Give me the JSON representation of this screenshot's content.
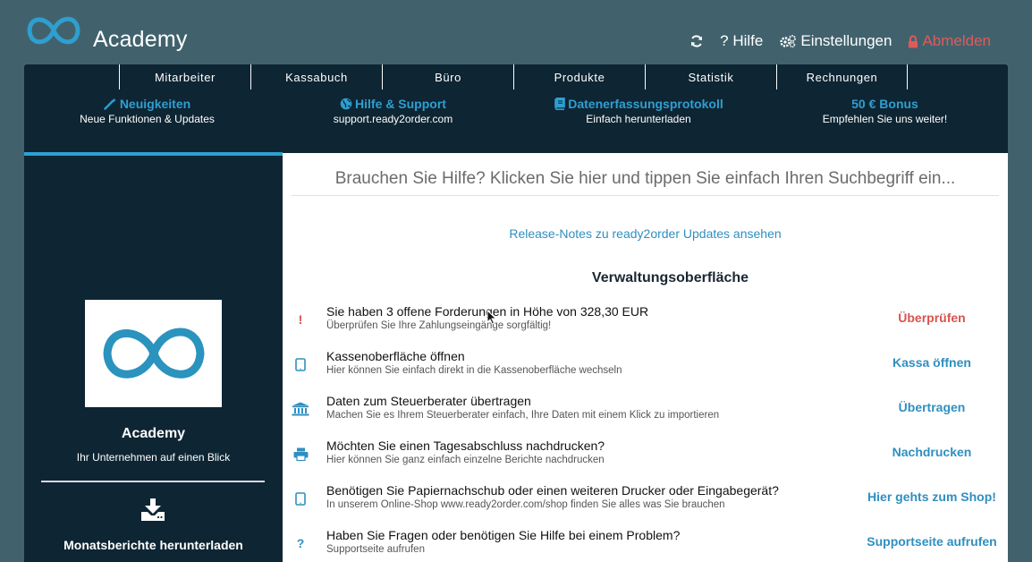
{
  "header": {
    "brand_name": "Academy",
    "actions": {
      "refresh_icon": "refresh-icon",
      "help_label": "? Hilfe",
      "settings_label": "Einstellungen",
      "logout_label": "Abmelden"
    }
  },
  "colors": {
    "background": "#41626d",
    "panel": "#0e2533",
    "accent": "#2f9fd0",
    "danger": "#d9534f"
  },
  "nav": {
    "items": [
      {
        "label": "Mitarbeiter"
      },
      {
        "label": "Kassabuch"
      },
      {
        "label": "Büro"
      },
      {
        "label": "Produkte"
      },
      {
        "label": "Statistik"
      },
      {
        "label": "Rechnungen"
      }
    ]
  },
  "promos": [
    {
      "title": "Neuigkeiten",
      "subtitle": "Neue Funktionen & Updates",
      "icon": "magic-wand-icon"
    },
    {
      "title": "Hilfe & Support",
      "subtitle": "support.ready2order.com",
      "icon": "globe-icon"
    },
    {
      "title": "Datenerfassungsprotokoll",
      "subtitle": "Einfach herunterladen",
      "icon": "book-icon"
    },
    {
      "title": "50 € Bonus",
      "subtitle": "Empfehlen Sie uns weiter!",
      "icon": ""
    }
  ],
  "sidebar": {
    "title": "Academy",
    "subtitle": "Ihr Unternehmen auf einen Blick",
    "download_label": "Monatsberichte herunterladen"
  },
  "main": {
    "search_placeholder": "Brauchen Sie Hilfe? Klicken Sie hier und tippen Sie einfach Ihren Suchbegriff ein...",
    "release_notes_link": "Release-Notes zu ready2order Updates ansehen",
    "section_title": "Verwaltungsoberfläche",
    "tasks": [
      {
        "icon_glyph": "!",
        "icon": "exclamation-icon",
        "title": "Sie haben 3 offene Forderungen in Höhe von 328,30 EUR",
        "subtitle": "Überprüfen Sie Ihre Zahlungseingänge sorgfältig!",
        "action": "Überprüfen"
      },
      {
        "icon_glyph": "",
        "icon": "tablet-icon",
        "title": "Kassenoberfläche öffnen",
        "subtitle": "Hier können Sie einfach direkt in die Kassenoberfläche wechseln",
        "action": "Kassa öffnen"
      },
      {
        "icon_glyph": "",
        "icon": "bank-icon",
        "title": "Daten zum Steuerberater übertragen",
        "subtitle": "Machen Sie es Ihrem Steuerberater einfach, Ihre Daten mit einem Klick zu importieren",
        "action": "Übertragen"
      },
      {
        "icon_glyph": "",
        "icon": "printer-icon",
        "title": "Möchten Sie einen Tagesabschluss nachdrucken?",
        "subtitle": "Hier können Sie ganz einfach einzelne Berichte nachdrucken",
        "action": "Nachdrucken"
      },
      {
        "icon_glyph": "",
        "icon": "tablet-icon",
        "title": "Benötigen Sie Papiernachschub oder einen weiteren Drucker oder Eingabegerät?",
        "subtitle": "In unserem Online-Shop www.ready2order.com/shop finden Sie alles was Sie brauchen",
        "action": "Hier gehts zum Shop!"
      },
      {
        "icon_glyph": "?",
        "icon": "question-icon",
        "title": "Haben Sie Fragen oder benötigen Sie Hilfe bei einem Problem?",
        "subtitle": "Supportseite aufrufen",
        "action": "Supportseite aufrufen"
      }
    ]
  }
}
